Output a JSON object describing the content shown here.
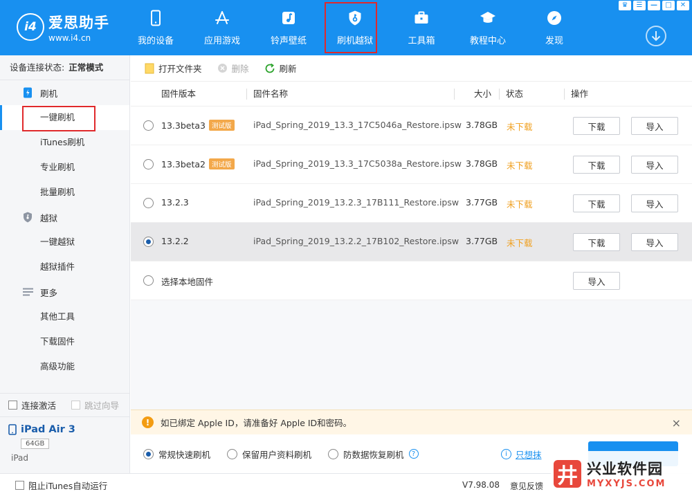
{
  "app": {
    "name": "爱思助手",
    "url": "www.i4.cn",
    "logo_glyph": "i4",
    "brand_color": "#1890f0"
  },
  "nav": [
    {
      "label": "我的设备",
      "icon": "phone-icon"
    },
    {
      "label": "应用游戏",
      "icon": "appstore-icon"
    },
    {
      "label": "铃声壁纸",
      "icon": "music-icon"
    },
    {
      "label": "刷机越狱",
      "icon": "shield-key-icon",
      "active": true
    },
    {
      "label": "工具箱",
      "icon": "toolbox-icon"
    },
    {
      "label": "教程中心",
      "icon": "graduation-cap-icon"
    },
    {
      "label": "发现",
      "icon": "compass-icon"
    }
  ],
  "sidebar": {
    "status_label": "设备连接状态:",
    "status_value": "正常模式",
    "groups": [
      {
        "label": "刷机",
        "icon": "flash-icon",
        "items": [
          "一键刷机",
          "iTunes刷机",
          "专业刷机",
          "批量刷机"
        ]
      },
      {
        "label": "越狱",
        "icon": "shield-icon",
        "items": [
          "一键越狱",
          "越狱插件"
        ]
      },
      {
        "label": "更多",
        "icon": "menu-icon",
        "items": [
          "其他工具",
          "下载固件",
          "高级功能"
        ]
      }
    ],
    "selected_item": "一键刷机",
    "auto_activate": "连接激活",
    "skip_guide": "跳过向导"
  },
  "device": {
    "name": "iPad Air 3",
    "capacity": "64GB",
    "type": "iPad"
  },
  "toolbar": {
    "open_folder": "打开文件夹",
    "delete": "删除",
    "refresh": "刷新"
  },
  "table": {
    "headers": {
      "version": "固件版本",
      "name": "固件名称",
      "size": "大小",
      "status": "状态",
      "action": "操作"
    },
    "rows": [
      {
        "version": "13.3beta3",
        "tag": "测试版",
        "name": "iPad_Spring_2019_13.3_17C5046a_Restore.ipsw",
        "size": "3.78GB",
        "status": "未下载",
        "download": "下载",
        "import": "导入",
        "selected": false
      },
      {
        "version": "13.3beta2",
        "tag": "测试版",
        "name": "iPad_Spring_2019_13.3_17C5038a_Restore.ipsw",
        "size": "3.78GB",
        "status": "未下载",
        "download": "下载",
        "import": "导入",
        "selected": false
      },
      {
        "version": "13.2.3",
        "tag": "",
        "name": "iPad_Spring_2019_13.2.3_17B111_Restore.ipsw",
        "size": "3.77GB",
        "status": "未下载",
        "download": "下载",
        "import": "导入",
        "selected": false
      },
      {
        "version": "13.2.2",
        "tag": "",
        "name": "iPad_Spring_2019_13.2.2_17B102_Restore.ipsw",
        "size": "3.77GB",
        "status": "未下载",
        "download": "下载",
        "import": "导入",
        "selected": true
      }
    ],
    "local_row": {
      "label": "选择本地固件",
      "import": "导入"
    }
  },
  "notice": {
    "text": "如已绑定 Apple ID，请准备好 Apple ID和密码。",
    "close": "×"
  },
  "modes": {
    "options": [
      "常规快速刷机",
      "保留用户资料刷机",
      "防数据恢复刷机"
    ],
    "selected": "常规快速刷机",
    "help": "?",
    "erase_link": "只想抹"
  },
  "statusbar": {
    "block_itunes": "阻止iTunes自动运行",
    "version": "V7.98.08",
    "feedback": "意见反馈"
  },
  "watermark": {
    "cn": "兴业软件园",
    "en": "MYXYJS.COM",
    "glyph": "井"
  },
  "window_controls": [
    "♛",
    "☰",
    "—",
    "□",
    "✕"
  ]
}
